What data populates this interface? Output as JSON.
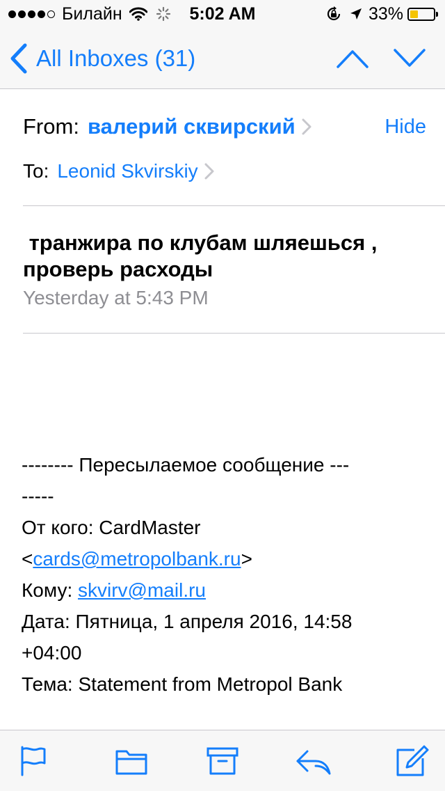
{
  "status_bar": {
    "signal_bars_filled": 4,
    "signal_bars_total": 5,
    "carrier": "Билайн",
    "time": "5:02 AM",
    "battery_percent": "33%",
    "battery_level": 0.33,
    "battery_color": "#f5c400",
    "icons": [
      "wifi-icon",
      "activity-spinner-icon",
      "orientation-lock-icon",
      "location-arrow-icon",
      "battery-icon"
    ]
  },
  "nav": {
    "back_label": "All Inboxes (31)",
    "accent": "#147efb",
    "icons": [
      "chevron-left-icon",
      "chevron-up-icon",
      "chevron-down-icon"
    ]
  },
  "header": {
    "from_label": "From:",
    "from_name": "валерий сквирский",
    "hide_label": "Hide",
    "to_label": "To:",
    "to_name": "Leonid Skvirskiy"
  },
  "message": {
    "subject_line1": " транжира по клубам шляешься ,",
    "subject_line2": "проверь расходы",
    "date": "Yesterday at 5:43 PM"
  },
  "body": {
    "line1": "-------- Пересылаемое сообщение ---",
    "line2": "-----",
    "from_prefix": "От кого: CardMaster",
    "from_open": "<",
    "from_email": "cards@metropolbank.ru",
    "from_close": ">",
    "to_prefix": "Кому: ",
    "to_email": "skvirv@mail.ru",
    "date_line1": "Дата: Пятница, 1 апреля 2016, 14:58",
    "date_line2": "+04:00",
    "subject_line": "Тема: Statement from Metropol Bank"
  },
  "toolbar": {
    "icons": [
      "flag-icon",
      "folder-icon",
      "archive-icon",
      "reply-icon",
      "compose-icon"
    ]
  }
}
